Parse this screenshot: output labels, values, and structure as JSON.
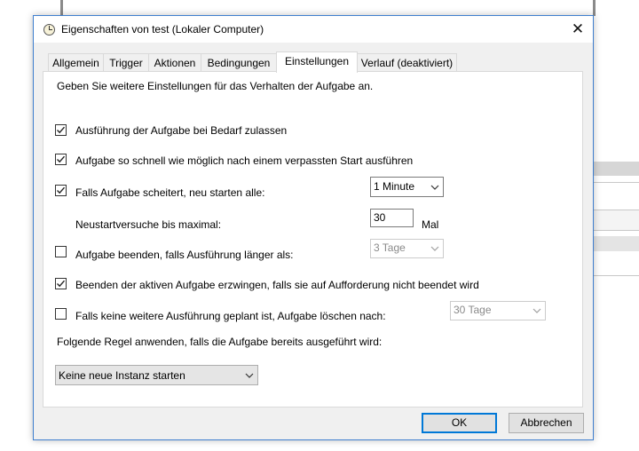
{
  "window": {
    "title": "Eigenschaften von test (Lokaler Computer)",
    "close_glyph": "✕"
  },
  "tabs": [
    {
      "label": "Allgemein",
      "active": false
    },
    {
      "label": "Trigger",
      "active": false
    },
    {
      "label": "Aktionen",
      "active": false
    },
    {
      "label": "Bedingungen",
      "active": false
    },
    {
      "label": "Einstellungen",
      "active": true
    },
    {
      "label": "Verlauf (deaktiviert)",
      "active": false
    }
  ],
  "settings": {
    "intro": "Geben Sie weitere Einstellungen für das Verhalten der Aufgabe an.",
    "allow_on_demand": {
      "label": "Ausführung der Aufgabe bei Bedarf zulassen",
      "checked": true
    },
    "run_after_missed": {
      "label": "Aufgabe so schnell wie möglich nach einem verpassten Start ausführen",
      "checked": true
    },
    "restart_on_failure": {
      "label": "Falls Aufgabe scheitert, neu starten alle:",
      "checked": true,
      "interval": "1 Minute"
    },
    "restart_attempts": {
      "label": "Neustartversuche bis maximal:",
      "value": "30",
      "unit": "Mal"
    },
    "stop_if_longer": {
      "label": "Aufgabe beenden, falls Ausführung länger als:",
      "checked": false,
      "duration": "3 Tage"
    },
    "force_stop": {
      "label": "Beenden der aktiven Aufgabe erzwingen, falls sie auf Aufforderung nicht beendet wird",
      "checked": true
    },
    "delete_if_not_scheduled": {
      "label": "Falls keine weitere Ausführung geplant ist, Aufgabe löschen nach:",
      "checked": false,
      "duration": "30 Tage"
    },
    "rule_label": "Folgende Regel anwenden, falls die Aufgabe bereits ausgeführt wird:",
    "rule_value": "Keine neue Instanz starten"
  },
  "buttons": {
    "ok": "OK",
    "cancel": "Abbrechen"
  },
  "colors": {
    "accent": "#0078d7",
    "window_border": "#3f7fcf",
    "dialog_bg": "#f0f0f0"
  },
  "icons": [
    "clock-icon",
    "close-icon",
    "check-icon",
    "chevron-down-icon"
  ]
}
